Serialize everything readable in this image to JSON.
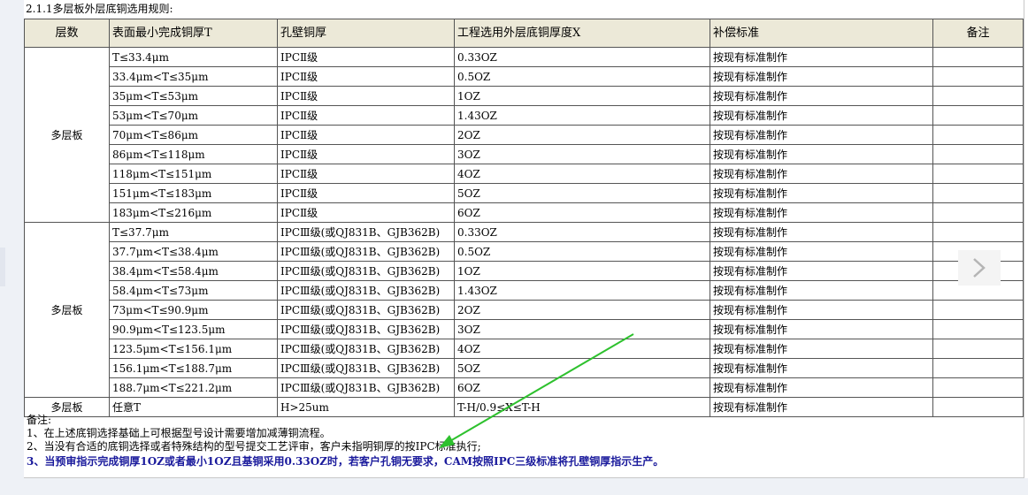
{
  "heading": "2.1.1多层板外层底铜选用规则:",
  "columns": [
    "层数",
    "表面最小完成铜厚T",
    "孔壁铜厚",
    "工程选用外层底铜厚度X",
    "补偿标准",
    "备注"
  ],
  "groups": [
    {
      "layer": "多层板",
      "rows": [
        [
          "T≤33.4μm",
          "IPCⅡ级",
          "0.33OZ",
          "按现有标准制作",
          ""
        ],
        [
          "33.4μm<T≤35μm",
          "IPCⅡ级",
          "0.5OZ",
          "按现有标准制作",
          ""
        ],
        [
          "35μm<T≤53μm",
          "IPCⅡ级",
          "1OZ",
          "按现有标准制作",
          ""
        ],
        [
          "53μm<T≤70μm",
          "IPCⅡ级",
          "1.43OZ",
          "按现有标准制作",
          ""
        ],
        [
          "70μm<T≤86μm",
          "IPCⅡ级",
          "2OZ",
          "按现有标准制作",
          ""
        ],
        [
          "86μm<T≤118μm",
          "IPCⅡ级",
          "3OZ",
          "按现有标准制作",
          ""
        ],
        [
          "118μm<T≤151μm",
          "IPCⅡ级",
          "4OZ",
          "按现有标准制作",
          ""
        ],
        [
          "151μm<T≤183μm",
          "IPCⅡ级",
          "5OZ",
          "按现有标准制作",
          ""
        ],
        [
          "183μm<T≤216μm",
          "IPCⅡ级",
          "6OZ",
          "按现有标准制作",
          ""
        ]
      ]
    },
    {
      "layer": "多层板",
      "rows": [
        [
          "T≤37.7μm",
          "IPCⅢ级(或QJ831B、GJB362B)",
          "0.33OZ",
          "按现有标准制作",
          ""
        ],
        [
          "37.7μm<T≤38.4μm",
          "IPCⅢ级(或QJ831B、GJB362B)",
          "0.5OZ",
          "按现有标准制作",
          ""
        ],
        [
          "38.4μm<T≤58.4μm",
          "IPCⅢ级(或QJ831B、GJB362B)",
          "1OZ",
          "按现有标准制作",
          ""
        ],
        [
          "58.4μm<T≤73μm",
          "IPCⅢ级(或QJ831B、GJB362B)",
          "1.43OZ",
          "按现有标准制作",
          ""
        ],
        [
          "73μm<T≤90.9μm",
          "IPCⅢ级(或QJ831B、GJB362B)",
          "2OZ",
          "按现有标准制作",
          ""
        ],
        [
          "90.9μm<T≤123.5μm",
          "IPCⅢ级(或QJ831B、GJB362B)",
          "3OZ",
          "按现有标准制作",
          ""
        ],
        [
          "123.5μm<T≤156.1μm",
          "IPCⅢ级(或QJ831B、GJB362B)",
          "4OZ",
          "按现有标准制作",
          ""
        ],
        [
          "156.1μm<T≤188.7μm",
          "IPCⅢ级(或QJ831B、GJB362B)",
          "5OZ",
          "按现有标准制作",
          ""
        ],
        [
          "188.7μm<T≤221.2μm",
          "IPCⅢ级(或QJ831B、GJB362B)",
          "6OZ",
          "按现有标准制作",
          ""
        ]
      ]
    },
    {
      "layer": "多层板",
      "rows": [
        [
          "任意T",
          "H>25um",
          "T-H/0.9≤X≤T-H",
          "按现有标准制作",
          ""
        ]
      ]
    }
  ],
  "notes": {
    "title": "备注:",
    "line1": "1、在上述底铜选择基础上可根据型号设计需要增加减薄铜流程。",
    "line2": "2、当没有合适的底铜选择或者特殊结构的型号提交工艺评审，客户未指明铜厚的按IPC标准执行;",
    "line3": "3、当预审指示完成铜厚1OZ或者最小1OZ且基铜采用0.33OZ时，若客户孔铜无要求，CAM按照IPC三级标准将孔壁铜厚指示生产。"
  },
  "colors": {
    "header_bg": "#ece9d8",
    "note3": "#1a1a9c",
    "arrow": "#2ec12e"
  },
  "icons": {
    "next": "chevron-right-icon",
    "annotation": "green-arrow-icon"
  }
}
